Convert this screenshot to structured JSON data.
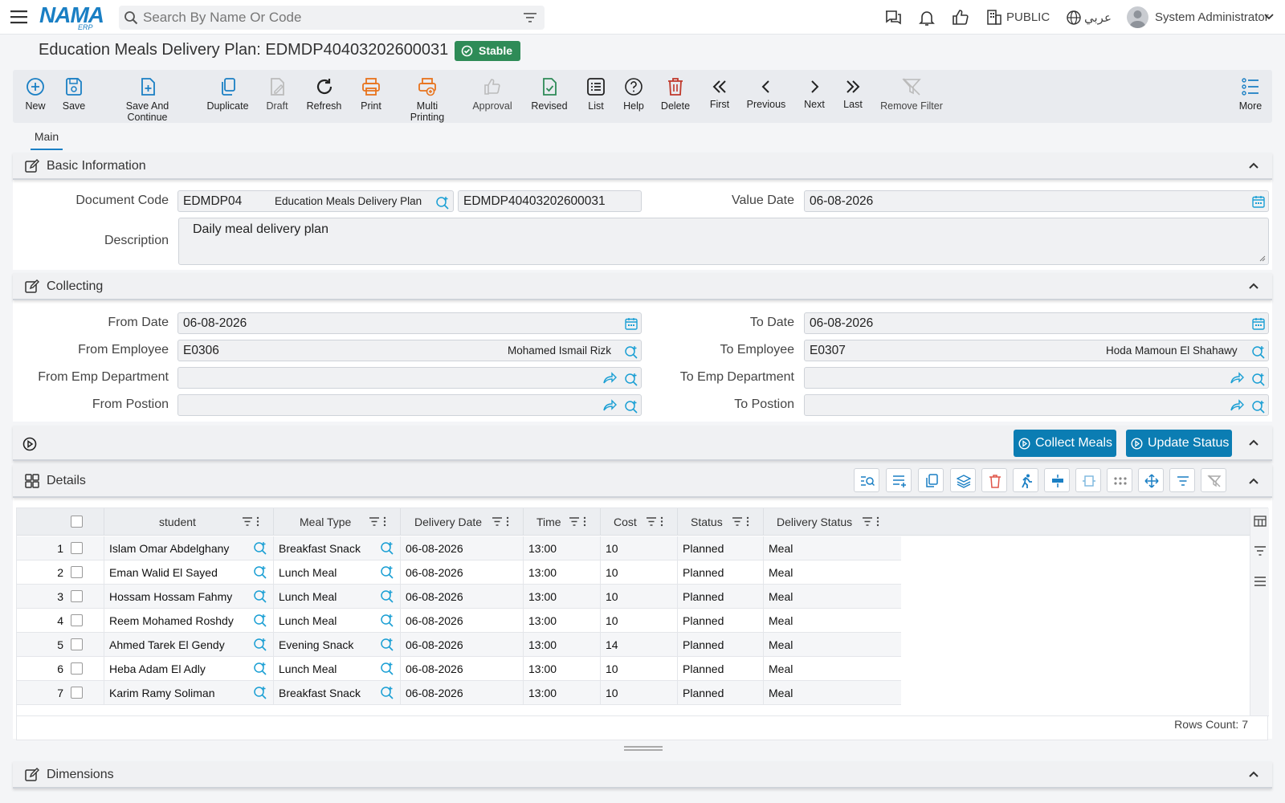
{
  "topbar": {
    "search_placeholder": "Search By Name Or Code",
    "branch": "PUBLIC",
    "language": "عربي",
    "user": "System Administrator"
  },
  "logo": {
    "word": "NAMA",
    "sub": "ERP"
  },
  "page": {
    "title": "Education Meals Delivery Plan: EDMDP40403202600031",
    "status": "Stable"
  },
  "toolbar": {
    "new": "New",
    "save": "Save",
    "save_continue": "Save And Continue",
    "duplicate": "Duplicate",
    "draft": "Draft",
    "refresh": "Refresh",
    "print": "Print",
    "multi_printing": "Multi Printing",
    "approval": "Approval",
    "revised": "Revised",
    "list": "List",
    "help": "Help",
    "delete": "Delete",
    "first": "First",
    "previous": "Previous",
    "next": "Next",
    "last": "Last",
    "remove_filter": "Remove Filter",
    "more": "More"
  },
  "tabs": {
    "main": "Main"
  },
  "basic": {
    "title": "Basic Information",
    "document_code_label": "Document Code",
    "doc_type_code": "EDMDP04",
    "doc_type_name": "Education Meals Delivery Plan",
    "doc_code": "EDMDP40403202600031",
    "value_date_label": "Value Date",
    "value_date": "06-08-2026",
    "description_label": "Description",
    "description": "Daily meal delivery plan"
  },
  "collecting": {
    "title": "Collecting",
    "from_date_label": "From Date",
    "from_date": "06-08-2026",
    "to_date_label": "To Date",
    "to_date": "06-08-2026",
    "from_employee_label": "From Employee",
    "from_employee_code": "E0306",
    "from_employee_name": "Mohamed Ismail Rizk",
    "to_employee_label": "To Employee",
    "to_employee_code": "E0307",
    "to_employee_name": "Hoda Mamoun El Shahawy",
    "from_dept_label": "From Emp Department",
    "to_dept_label": "To Emp Department",
    "from_pos_label": "From Postion",
    "to_pos_label": "To Postion"
  },
  "actions": {
    "collect": "Collect Meals",
    "update": "Update Status"
  },
  "details": {
    "title": "Details",
    "headers": {
      "student": "student",
      "meal_type": "Meal Type",
      "delivery_date": "Delivery Date",
      "time": "Time",
      "cost": "Cost",
      "status": "Status",
      "delivery_status": "Delivery Status"
    },
    "rows": [
      {
        "n": "1",
        "student": "Islam Omar Abdelghany",
        "meal": "Breakfast Snack",
        "date": "06-08-2026",
        "time": "13:00",
        "cost": "10",
        "status": "Planned",
        "dstatus": "Meal"
      },
      {
        "n": "2",
        "student": "Eman Walid El Sayed",
        "meal": "Lunch Meal",
        "date": "06-08-2026",
        "time": "13:00",
        "cost": "10",
        "status": "Planned",
        "dstatus": "Meal"
      },
      {
        "n": "3",
        "student": "Hossam Hossam Fahmy",
        "meal": "Lunch Meal",
        "date": "06-08-2026",
        "time": "13:00",
        "cost": "10",
        "status": "Planned",
        "dstatus": "Meal"
      },
      {
        "n": "4",
        "student": "Reem Mohamed Roshdy",
        "meal": "Lunch Meal",
        "date": "06-08-2026",
        "time": "13:00",
        "cost": "10",
        "status": "Planned",
        "dstatus": "Meal"
      },
      {
        "n": "5",
        "student": "Ahmed Tarek El Gendy",
        "meal": "Evening Snack",
        "date": "06-08-2026",
        "time": "13:00",
        "cost": "14",
        "status": "Planned",
        "dstatus": "Meal"
      },
      {
        "n": "6",
        "student": "Heba Adam El Adly",
        "meal": "Lunch Meal",
        "date": "06-08-2026",
        "time": "13:00",
        "cost": "10",
        "status": "Planned",
        "dstatus": "Meal"
      },
      {
        "n": "7",
        "student": "Karim Ramy Soliman",
        "meal": "Breakfast Snack",
        "date": "06-08-2026",
        "time": "13:00",
        "cost": "10",
        "status": "Planned",
        "dstatus": "Meal"
      }
    ],
    "rows_count": "Rows Count: 7"
  },
  "dimensions": {
    "title": "Dimensions"
  },
  "colors": {
    "accent": "#1a7fc4",
    "action": "#0b7db3",
    "stable": "#2e8b57",
    "print": "#e8731c",
    "delete": "#c0392b",
    "revised": "#2e8b57"
  }
}
